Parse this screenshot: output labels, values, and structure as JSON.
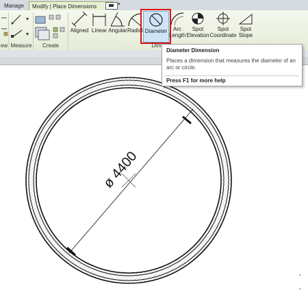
{
  "tabs": {
    "manage": "Manage",
    "active": "Modify | Place Dimensions"
  },
  "ribbon": {
    "panels": {
      "view": "ew",
      "measure": "Measure",
      "create": "Create",
      "dimension": "Dimen"
    },
    "tools": {
      "aligned": "Aligned",
      "linear": "Linear",
      "angular": "Angular",
      "radial": "Radial",
      "diameter": "Diameter",
      "arc_length_1": "Arc",
      "arc_length_2": "Length",
      "spot_elevation_1": "Spot",
      "spot_elevation_2": "Elevation",
      "spot_coordinate_1": "Spot",
      "spot_coordinate_2": "Coordinate",
      "spot_slope_1": "Spot",
      "spot_slope_2": "Slope"
    }
  },
  "tooltip": {
    "title": "Diameter Dimension",
    "description": "Places a dimension that measures the diameter of an arc or circle.",
    "help": "Press F1 for more help"
  },
  "drawing": {
    "dimension_text": "ø 4400"
  }
}
